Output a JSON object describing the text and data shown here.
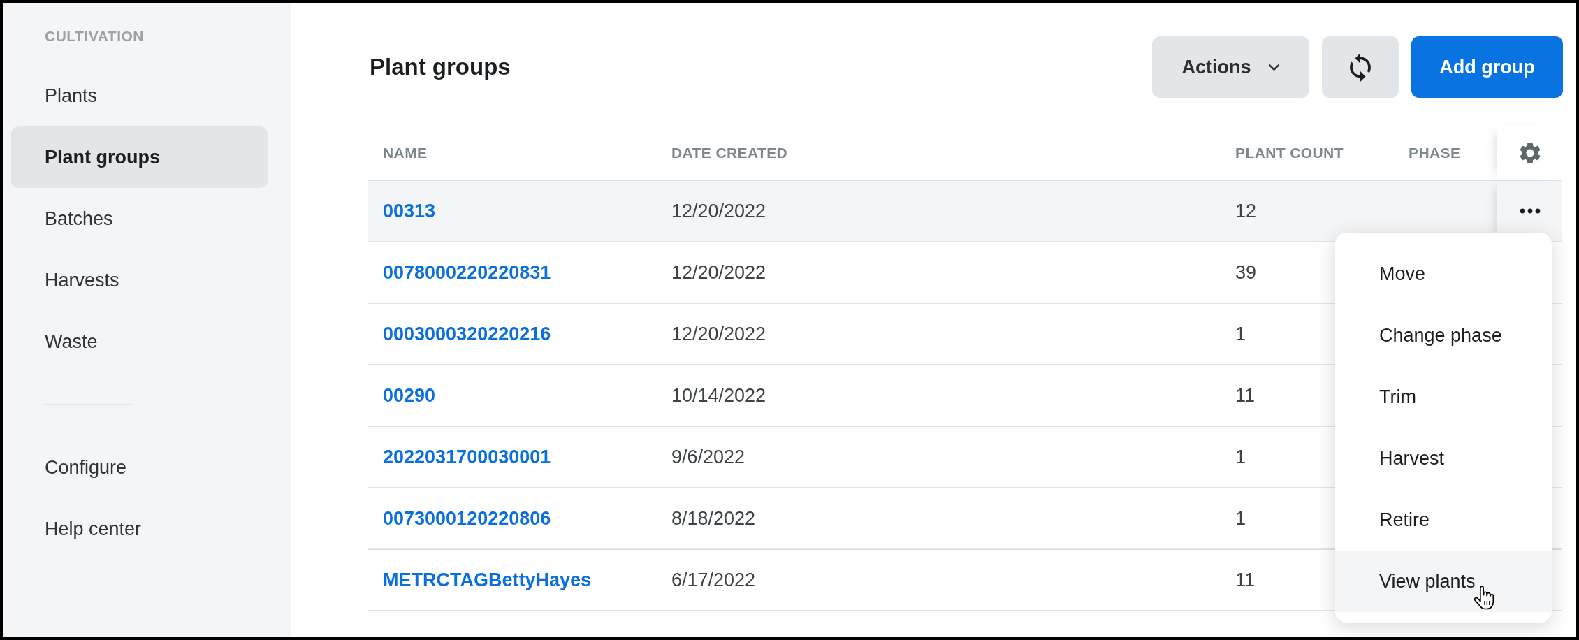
{
  "sidebar": {
    "section_title": "CULTIVATION",
    "items": [
      {
        "label": "Plants",
        "selected": false
      },
      {
        "label": "Plant groups",
        "selected": true
      },
      {
        "label": "Batches",
        "selected": false
      },
      {
        "label": "Harvests",
        "selected": false
      },
      {
        "label": "Waste",
        "selected": false
      }
    ],
    "footer_items": [
      {
        "label": "Configure",
        "selected": false
      },
      {
        "label": "Help center",
        "selected": false
      }
    ]
  },
  "header": {
    "title": "Plant groups",
    "actions_button": "Actions",
    "add_button": "Add group"
  },
  "table": {
    "columns": [
      "NAME",
      "DATE CREATED",
      "PLANT COUNT",
      "PHASE"
    ],
    "rows": [
      {
        "name": "00313",
        "date_created": "12/20/2022",
        "plant_count": "12",
        "menu_open": true
      },
      {
        "name": "0078000220220831",
        "date_created": "12/20/2022",
        "plant_count": "39",
        "menu_open": false
      },
      {
        "name": "0003000320220216",
        "date_created": "12/20/2022",
        "plant_count": "1",
        "menu_open": false
      },
      {
        "name": "00290",
        "date_created": "10/14/2022",
        "plant_count": "11",
        "menu_open": false
      },
      {
        "name": "2022031700030001",
        "date_created": "9/6/2022",
        "plant_count": "1",
        "menu_open": false
      },
      {
        "name": "0073000120220806",
        "date_created": "8/18/2022",
        "plant_count": "1",
        "menu_open": false
      },
      {
        "name": "METRCTAGBettyHayes",
        "date_created": "6/17/2022",
        "plant_count": "11",
        "menu_open": false
      }
    ]
  },
  "row_menu": {
    "items": [
      {
        "label": "Move",
        "highlighted": false
      },
      {
        "label": "Change phase",
        "highlighted": false
      },
      {
        "label": "Trim",
        "highlighted": false
      },
      {
        "label": "Harvest",
        "highlighted": false
      },
      {
        "label": "Retire",
        "highlighted": false
      },
      {
        "label": "View plants",
        "highlighted": true
      }
    ]
  }
}
